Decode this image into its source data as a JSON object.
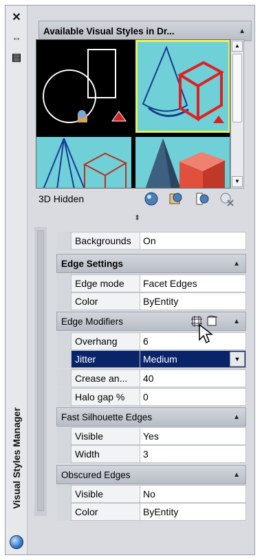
{
  "titlebar": {
    "close_glyph": "✕",
    "autohide_glyph": "⇔",
    "properties_glyph": "▤",
    "vertical_title": "Visual Styles Manager"
  },
  "available": {
    "header": "Available Visual Styles in Dr...",
    "selected_style": "3D Hidden",
    "tool_icons": [
      "create-visual-style-icon",
      "apply-to-viewport-icon",
      "export-tool-palette-icon",
      "delete-icon"
    ]
  },
  "properties": {
    "top_row": {
      "name": "Backgrounds",
      "value": "On"
    },
    "edge_settings": {
      "header": "Edge Settings",
      "rows": [
        {
          "name": "Edge mode",
          "value": "Facet Edges"
        },
        {
          "name": "Color",
          "value": "ByEntity"
        }
      ]
    },
    "edge_modifiers": {
      "header": "Edge Modifiers",
      "rows": [
        {
          "name": "Overhang",
          "value": "6"
        },
        {
          "name": "Jitter",
          "value": "Medium",
          "selected": true
        },
        {
          "name": "Crease an...",
          "value": "40"
        },
        {
          "name": "Halo gap %",
          "value": "0"
        }
      ]
    },
    "fast_silhouette": {
      "header": "Fast Silhouette Edges",
      "rows": [
        {
          "name": "Visible",
          "value": "Yes"
        },
        {
          "name": "Width",
          "value": "3"
        }
      ]
    },
    "obscured_edges": {
      "header": "Obscured Edges",
      "rows": [
        {
          "name": "Visible",
          "value": "No"
        },
        {
          "name": "Color",
          "value": "ByEntity"
        }
      ]
    }
  },
  "colors": {
    "selection": "#0a246a",
    "thumb_highlight": "#e8f060",
    "thumb_bg_cyan": "#6fd0d8",
    "thumb_red": "#e32020"
  }
}
